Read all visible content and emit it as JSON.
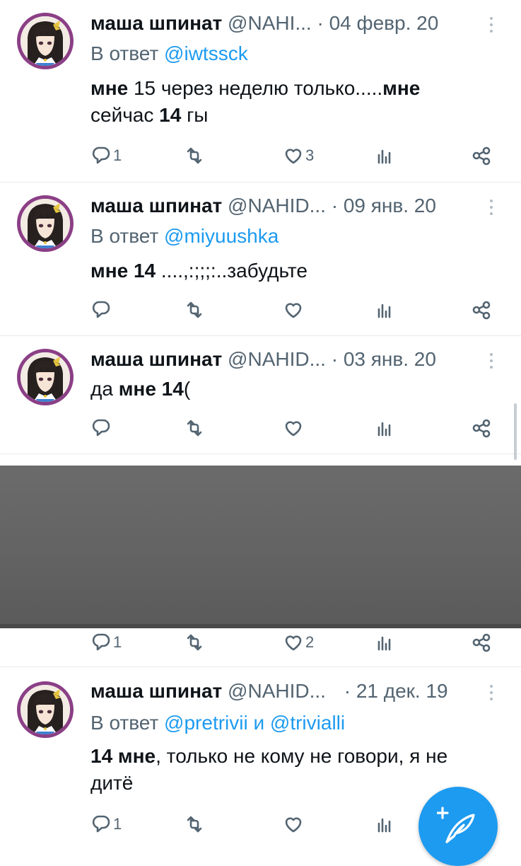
{
  "tweets": [
    {
      "name": "маша шпинат",
      "handle": "@NAHI...",
      "date": "04 февр. 20",
      "reply_prefix": "В ответ ",
      "reply_mentions": "@iwtssck",
      "text_parts": [
        {
          "t": "мне",
          "b": true
        },
        {
          "t": " 15 через неделю только.....",
          "b": false
        },
        {
          "t": "мне",
          "b": true
        },
        {
          "t": " сейчас ",
          "b": false
        },
        {
          "t": "14",
          "b": true
        },
        {
          "t": " гы",
          "b": false
        }
      ],
      "replies": "1",
      "retweets": "",
      "likes": "3"
    },
    {
      "name": "маша шпинат",
      "handle": "@NAHID...",
      "date": "09 янв. 20",
      "reply_prefix": "В ответ ",
      "reply_mentions": "@miyuushka",
      "text_parts": [
        {
          "t": "мне 14",
          "b": true
        },
        {
          "t": " ....,:;;;:..забудьте",
          "b": false
        }
      ],
      "replies": "",
      "retweets": "",
      "likes": ""
    },
    {
      "name": "маша шпинат",
      "handle": "@NAHID...",
      "date": "03 янв. 20",
      "reply_prefix": "",
      "reply_mentions": "",
      "text_parts": [
        {
          "t": "да ",
          "b": false
        },
        {
          "t": "мне 14",
          "b": true
        },
        {
          "t": "(",
          "b": false
        }
      ],
      "replies": "",
      "retweets": "",
      "likes": ""
    },
    {
      "name": "",
      "handle": "",
      "date": "",
      "reply_prefix": "",
      "reply_mentions": "",
      "text_parts": [],
      "replies": "1",
      "retweets": "",
      "likes": "2"
    },
    {
      "name": "маша шпинат",
      "handle": "@NAHID...",
      "date": "21 дек. 19",
      "reply_prefix": "В ответ ",
      "reply_mentions": "@pretrivii и @trivialli",
      "text_parts": [
        {
          "t": "14 мне",
          "b": true
        },
        {
          "t": ", только не кому не говори, я не дитё",
          "b": false
        }
      ],
      "replies": "1",
      "retweets": "",
      "likes": ""
    }
  ],
  "dot": "·",
  "icons": {
    "reply": "reply-icon",
    "retweet": "retweet-icon",
    "like": "like-icon",
    "views": "views-icon",
    "share": "share-icon",
    "more": "more-icon",
    "compose": "compose-icon"
  },
  "colors": {
    "accent": "#1d9bf0",
    "muted": "#536471",
    "text": "#0f1419",
    "redacted_block": "#636363"
  }
}
